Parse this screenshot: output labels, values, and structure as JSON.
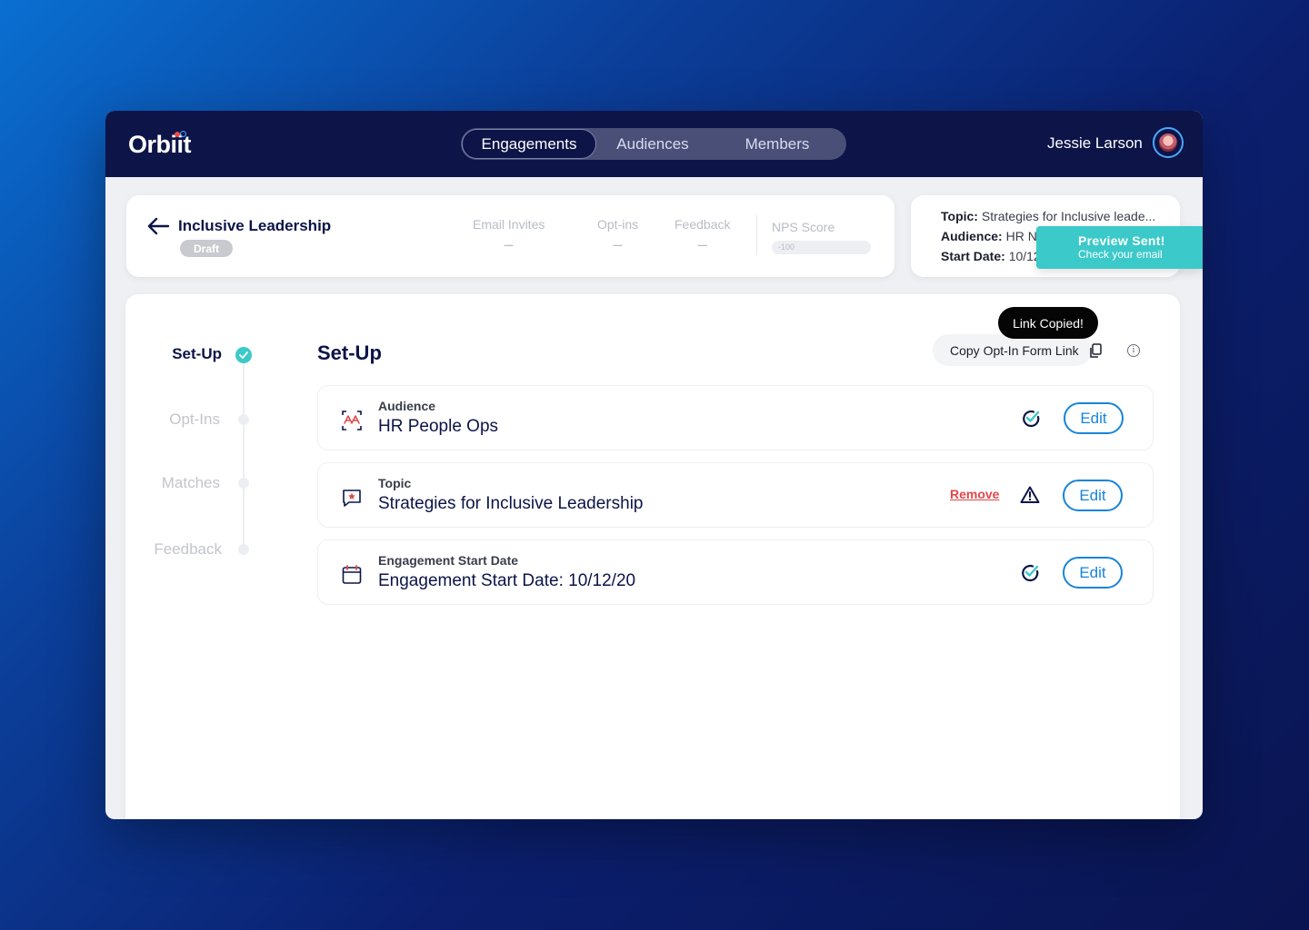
{
  "app": {
    "logo": "Orbiit",
    "nav_tabs": [
      "Engagements",
      "Audiences",
      "Members"
    ],
    "user_name": "Jessie Larson"
  },
  "summary": {
    "title": "Inclusive Leadership",
    "status": "Draft",
    "stats": [
      {
        "label": "Email Invites",
        "value": "–"
      },
      {
        "label": "Opt-ins",
        "value": "–"
      },
      {
        "label": "Feedback",
        "value": "–"
      }
    ],
    "nps_label": "NPS Score",
    "nps_value": "-100"
  },
  "info": {
    "topic_label": "Topic:",
    "topic_value": "Strategies for Inclusive leade...",
    "audience_label": "Audience:",
    "audience_value": "HR Ne",
    "start_label": "Start Date:",
    "start_value": "10/12"
  },
  "toast": {
    "title": "Preview Sent!",
    "subtitle": "Check your email"
  },
  "steps": [
    "Set-Up",
    "Opt-Ins",
    "Matches",
    "Feedback"
  ],
  "setup": {
    "title": "Set-Up",
    "copy_link_label": "Copy Opt-In Form Link",
    "tooltip": "Link Copied!",
    "info_glyph": "i",
    "edit_label": "Edit",
    "remove_label": "Remove",
    "rows": [
      {
        "label": "Audience",
        "value": "HR People Ops",
        "status": "complete"
      },
      {
        "label": "Topic",
        "value": "Strategies for Inclusive Leadership",
        "status": "warning"
      },
      {
        "label": "Engagement Start Date",
        "value": "Engagement Start Date: 10/12/20",
        "status": "complete"
      }
    ]
  },
  "colors": {
    "navy": "#0c1448",
    "accent_teal": "#3cc9c9",
    "accent_blue": "#1784d8",
    "danger": "#e0484b"
  },
  "icons": [
    "back-arrow-icon",
    "audience-icon",
    "topic-chat-icon",
    "calendar-icon",
    "check-circle-icon",
    "warning-icon",
    "copy-icon",
    "info-icon",
    "avatar"
  ]
}
